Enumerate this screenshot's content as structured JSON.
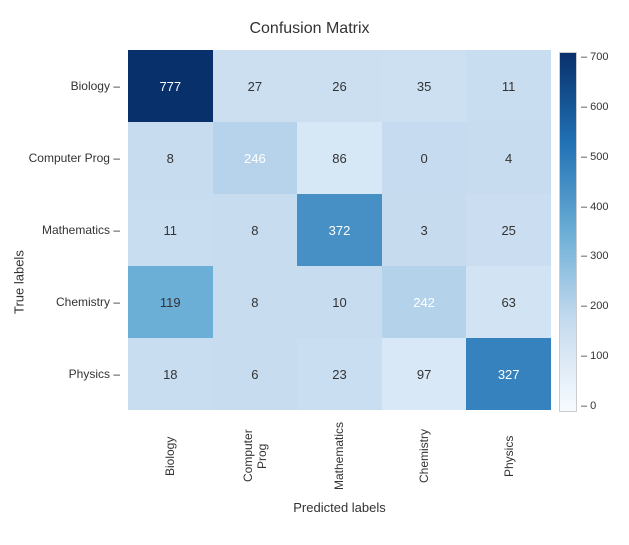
{
  "title": "Confusion Matrix",
  "y_axis_label": "True labels",
  "x_axis_label": "Predicted labels",
  "row_labels": [
    "Biology",
    "Computer Prog",
    "Mathematics",
    "Chemistry",
    "Physics"
  ],
  "col_labels": [
    "Biology",
    "Computer Prog",
    "Mathematics",
    "Chemistry",
    "Physics"
  ],
  "cells": [
    [
      777,
      27,
      26,
      35,
      11
    ],
    [
      8,
      246,
      86,
      0,
      4
    ],
    [
      11,
      8,
      372,
      3,
      25
    ],
    [
      119,
      8,
      10,
      242,
      63
    ],
    [
      18,
      6,
      23,
      97,
      327
    ]
  ],
  "colorbar_ticks": [
    "700",
    "600",
    "500",
    "400",
    "300",
    "200",
    "100",
    "0"
  ],
  "max_value": 777,
  "min_value": 0
}
